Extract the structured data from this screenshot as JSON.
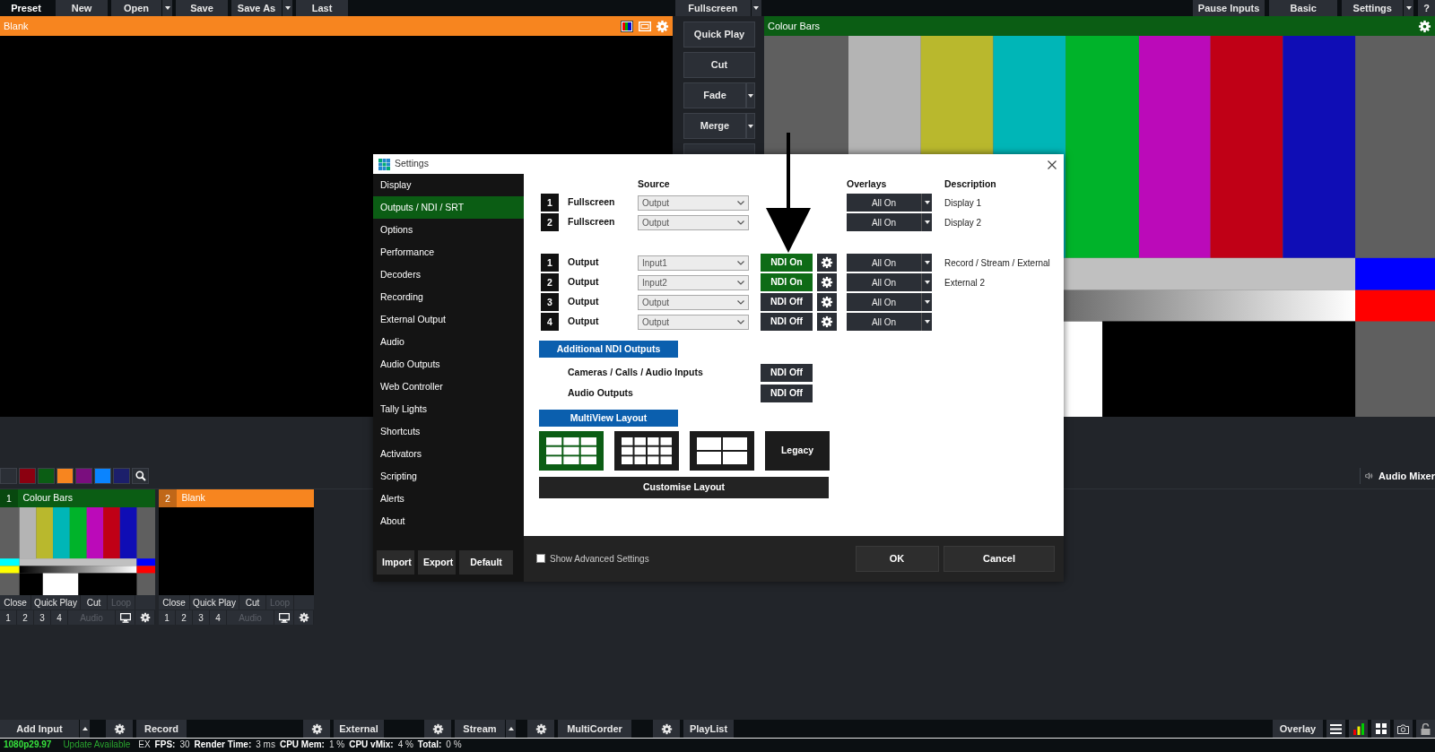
{
  "toolbar": {
    "left": [
      {
        "kind": "label",
        "label": "Preset",
        "dropdown": false
      },
      {
        "kind": "button",
        "label": "New",
        "dropdown": false
      },
      {
        "kind": "button",
        "label": "Open",
        "dropdown": true
      },
      {
        "kind": "button",
        "label": "Save",
        "dropdown": false
      },
      {
        "kind": "button",
        "label": "Save As",
        "dropdown": true
      },
      {
        "kind": "button",
        "label": "Last",
        "dropdown": false
      }
    ],
    "center": [
      {
        "label": "Fullscreen",
        "dropdown": true
      }
    ],
    "right": [
      {
        "label": "Pause Inputs",
        "dropdown": false
      },
      {
        "label": "Basic",
        "dropdown": false
      },
      {
        "label": "Settings",
        "dropdown": true
      },
      {
        "label": "?",
        "dropdown": false
      }
    ]
  },
  "preview": {
    "title": "Blank"
  },
  "transitions": [
    {
      "label": "Quick Play",
      "dropdown": false
    },
    {
      "label": "Cut",
      "dropdown": false
    },
    {
      "label": "Fade",
      "dropdown": true
    },
    {
      "label": "Merge",
      "dropdown": true
    }
  ],
  "output": {
    "title": "Colour Bars"
  },
  "color_filters": [
    {
      "color": "#2b2f36"
    },
    {
      "color": "#8b0010"
    },
    {
      "color": "#0b5d14"
    },
    {
      "color": "#f7851f"
    },
    {
      "color": "#7a0e7e"
    },
    {
      "color": "#0a84ff"
    },
    {
      "color": "#1c1f6b"
    }
  ],
  "audio_mixer": {
    "label": "Audio Mixer"
  },
  "inputs": [
    {
      "number": "1",
      "title": "Colour Bars",
      "color": "#0b5d14",
      "kind": "bars",
      "buttons": [
        {
          "label": "Close",
          "disabled": false
        },
        {
          "label": "Quick Play",
          "disabled": false
        },
        {
          "label": "Cut",
          "disabled": false
        },
        {
          "label": "Loop",
          "disabled": true
        }
      ],
      "overlays": [
        "1",
        "2",
        "3",
        "4"
      ],
      "audio": {
        "label": "Audio",
        "disabled": true
      }
    },
    {
      "number": "2",
      "title": "Blank",
      "color": "#f7851f",
      "kind": "blank",
      "buttons": [
        {
          "label": "Close",
          "disabled": false
        },
        {
          "label": "Quick Play",
          "disabled": false
        },
        {
          "label": "Cut",
          "disabled": false
        },
        {
          "label": "Loop",
          "disabled": true
        }
      ],
      "overlays": [
        "1",
        "2",
        "3",
        "4"
      ],
      "audio": {
        "label": "Audio",
        "disabled": true
      }
    }
  ],
  "bottom_bar": {
    "groups": [
      [
        {
          "kind": "button",
          "label": "Add Input",
          "dropdown": true
        }
      ],
      [
        {
          "kind": "gear"
        },
        {
          "kind": "button",
          "label": "Record",
          "dropdown": false
        }
      ],
      [
        {
          "kind": "gear"
        },
        {
          "kind": "button",
          "label": "External",
          "dropdown": false
        }
      ],
      [
        {
          "kind": "gear"
        },
        {
          "kind": "button",
          "label": "Stream",
          "dropdown": true
        }
      ],
      [
        {
          "kind": "gear"
        },
        {
          "kind": "button",
          "label": "MultiCorder",
          "dropdown": false
        }
      ],
      [
        {
          "kind": "gear"
        },
        {
          "kind": "button",
          "label": "PlayList",
          "dropdown": false
        }
      ]
    ],
    "overlay": {
      "label": "Overlay"
    }
  },
  "status_bar": [
    {
      "kind": "format",
      "text": "1080p29.97"
    },
    {
      "kind": "notice",
      "text": "Update Available"
    },
    {
      "kind": "value",
      "text": "EX"
    },
    {
      "kind": "key",
      "text": "FPS:"
    },
    {
      "kind": "value",
      "text": "30"
    },
    {
      "kind": "key",
      "text": "Render Time:"
    },
    {
      "kind": "value",
      "text": "3 ms"
    },
    {
      "kind": "key",
      "text": "CPU Mem:"
    },
    {
      "kind": "value",
      "text": "1 %"
    },
    {
      "kind": "key",
      "text": "CPU vMix:"
    },
    {
      "kind": "value",
      "text": "4 %"
    },
    {
      "kind": "key",
      "text": "Total:"
    },
    {
      "kind": "value",
      "text": "0 %"
    }
  ],
  "dialog": {
    "title": "Settings",
    "sidebar": [
      {
        "label": "Display",
        "selected": false
      },
      {
        "label": "Outputs / NDI / SRT",
        "selected": true
      },
      {
        "label": "Options",
        "selected": false
      },
      {
        "label": "Performance",
        "selected": false
      },
      {
        "label": "Decoders",
        "selected": false
      },
      {
        "label": "Recording",
        "selected": false
      },
      {
        "label": "External Output",
        "selected": false
      },
      {
        "label": "Audio",
        "selected": false
      },
      {
        "label": "Audio Outputs",
        "selected": false
      },
      {
        "label": "Web Controller",
        "selected": false
      },
      {
        "label": "Tally Lights",
        "selected": false
      },
      {
        "label": "Shortcuts",
        "selected": false
      },
      {
        "label": "Activators",
        "selected": false
      },
      {
        "label": "Scripting",
        "selected": false
      },
      {
        "label": "Alerts",
        "selected": false
      },
      {
        "label": "About",
        "selected": false
      }
    ],
    "sidebar_buttons": [
      "Import",
      "Export",
      "Default"
    ],
    "columns": {
      "source": "Source",
      "overlays": "Overlays",
      "description": "Description"
    },
    "fullscreen_rows": [
      {
        "number": "1",
        "label": "Fullscreen",
        "source": "Output",
        "overlays": "All On",
        "description": "Display 1"
      },
      {
        "number": "2",
        "label": "Fullscreen",
        "source": "Output",
        "overlays": "All On",
        "description": "Display 2"
      }
    ],
    "output_rows": [
      {
        "number": "1",
        "label": "Output",
        "source": "Input1",
        "ndi": {
          "label": "NDI On",
          "on": true
        },
        "overlays": "All On",
        "description": "Record / Stream / External"
      },
      {
        "number": "2",
        "label": "Output",
        "source": "Input2",
        "ndi": {
          "label": "NDI On",
          "on": true
        },
        "overlays": "All On",
        "description": "External 2"
      },
      {
        "number": "3",
        "label": "Output",
        "source": "Output",
        "ndi": {
          "label": "NDI Off",
          "on": false
        },
        "overlays": "All On"
      },
      {
        "number": "4",
        "label": "Output",
        "source": "Output",
        "ndi": {
          "label": "NDI Off",
          "on": false
        },
        "overlays": "All On"
      }
    ],
    "additional_ndi": {
      "heading": "Additional NDI Outputs",
      "rows": [
        {
          "label": "Cameras / Calls / Audio Inputs",
          "ndi": {
            "label": "NDI Off",
            "on": false
          }
        },
        {
          "label": "Audio Outputs",
          "ndi": {
            "label": "NDI Off",
            "on": false
          }
        }
      ]
    },
    "multiview": {
      "heading": "MultiView Layout",
      "layouts": [
        {
          "kind": "three-column",
          "selected": true
        },
        {
          "kind": "four-column",
          "selected": false
        },
        {
          "kind": "quad",
          "selected": false
        },
        {
          "kind": "legacy",
          "label": "Legacy",
          "selected": false
        }
      ],
      "customise": "Customise Layout"
    },
    "show_advanced": {
      "label": "Show Advanced Settings",
      "checked": false
    },
    "buttons": [
      "OK",
      "Cancel"
    ]
  }
}
